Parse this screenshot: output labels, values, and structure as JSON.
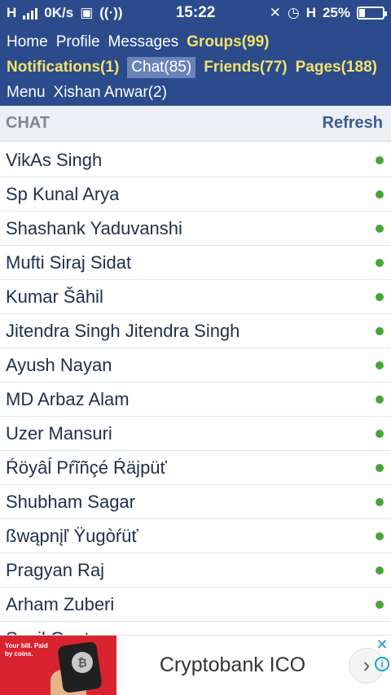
{
  "status_bar": {
    "network": "H",
    "speed": "0K/s",
    "time": "15:22",
    "battery_pct": "25%",
    "battery_level": 0.25
  },
  "nav": {
    "row1": [
      "Home",
      "Profile",
      "Messages"
    ],
    "groups": "Groups(99)",
    "notifications": "Notifications(1)",
    "chat": "Chat(85)",
    "friends": "Friends(77)",
    "pages": "Pages(188)",
    "menu": "Menu",
    "user": "Xishan Anwar(2)"
  },
  "chat_header": {
    "title": "CHAT",
    "refresh": "Refresh"
  },
  "chat_list": [
    "VikAs Singh",
    "Sp Kunal Arya",
    "Shashank Yaduvanshi",
    "Mufti Siraj Sidat",
    "Kumar Šâhil",
    "Jitendra Singh Jitendra Singh",
    "Ayush Nayan",
    "MD Arbaz Alam",
    "Uzer Mansuri",
    "Ŕöyâĺ Pŕĩñçé Ŕäjpüť",
    "Shubham Sagar",
    "ßwąpnįľ Ÿugòŕüť",
    "Pragyan Raj",
    "Arham Zuberi",
    "Sunil Gupta"
  ],
  "ad": {
    "title": "Cryptobank ICO",
    "next_icon": "chevron-right-icon",
    "close_icon": "close-icon",
    "info_icon": "info-icon",
    "thumb_text": "Your bill. Paid by coins.",
    "brand": "Cryptobank ICO"
  },
  "colors": {
    "header_bg": "#2b4b8c",
    "highlight": "#f4e26a",
    "online_dot": "#4aa43a",
    "refresh": "#3b5998"
  }
}
